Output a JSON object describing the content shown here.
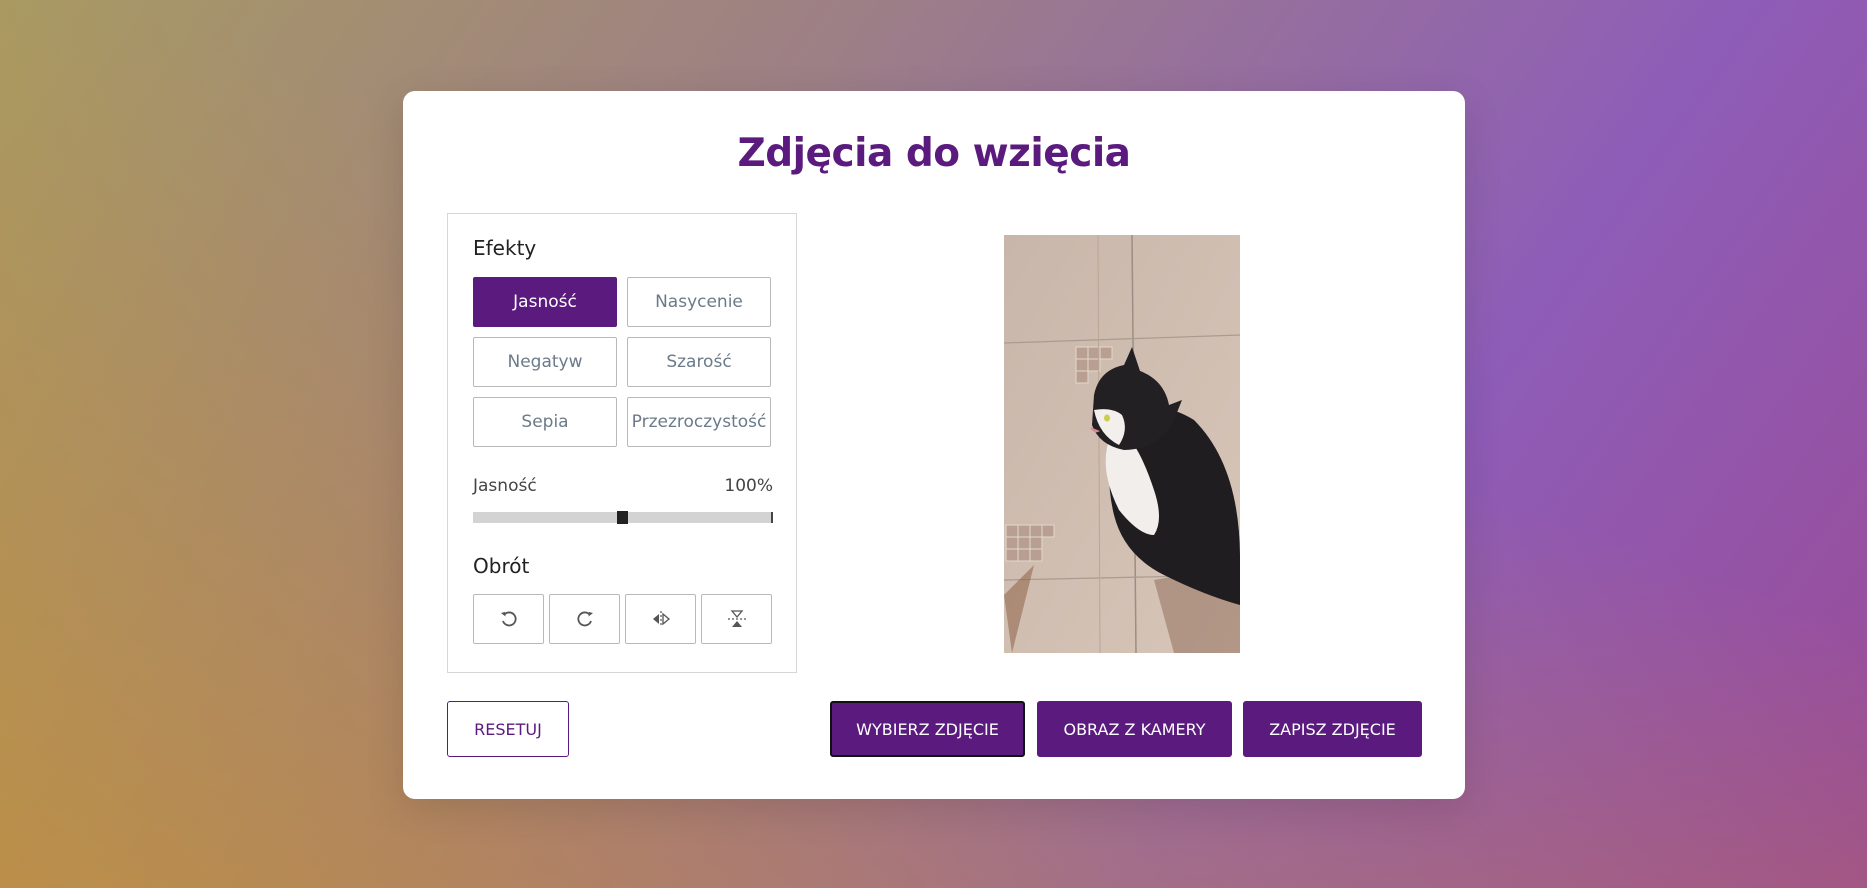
{
  "title": "Zdjęcia do wzięcia",
  "effects": {
    "heading": "Efekty",
    "buttons": [
      {
        "label": "Jasność",
        "active": true
      },
      {
        "label": "Nasycenie",
        "active": false
      },
      {
        "label": "Negatyw",
        "active": false
      },
      {
        "label": "Szarość",
        "active": false
      },
      {
        "label": "Sepia",
        "active": false
      },
      {
        "label": "Przezroczystość",
        "active": false
      }
    ],
    "slider": {
      "label": "Jasność",
      "value_text": "100%",
      "fraction": 0.5
    }
  },
  "rotation": {
    "heading": "Obrót",
    "icons": [
      "rotate-left-icon",
      "rotate-right-icon",
      "flip-horizontal-icon",
      "flip-vertical-icon"
    ]
  },
  "actions": {
    "reset": "RESETUJ",
    "choose": "WYBIERZ ZDJĘCIE",
    "camera": "OBRAZ Z KAMERY",
    "save": "ZAPISZ ZDJĘCIE"
  },
  "colors": {
    "accent": "#5b1a7e"
  }
}
